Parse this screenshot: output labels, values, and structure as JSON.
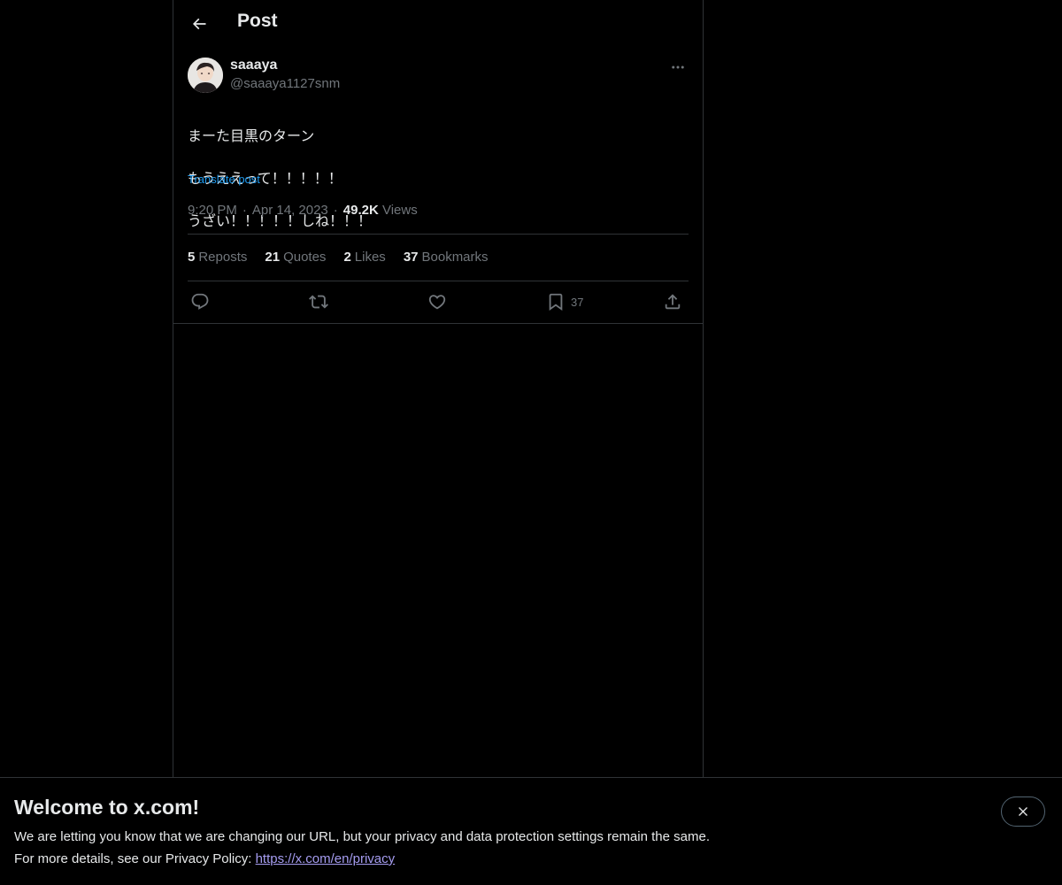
{
  "header": {
    "title": "Post",
    "back_icon": "arrow-left-icon"
  },
  "post": {
    "author_name": "saaaya",
    "author_handle": "@saaaya1127snm",
    "text_lines": [
      "まーた目黒のターン",
      "もうええって！！！！！",
      "うざい！！！！！しね！！！"
    ],
    "translate_label": "Translate post",
    "time": "9:20 PM",
    "date": "Apr 14, 2023",
    "separator": "·",
    "views_count": "49.2K",
    "views_label": "Views"
  },
  "stats": {
    "reposts": {
      "count": "5",
      "label": "Reposts"
    },
    "quotes": {
      "count": "21",
      "label": "Quotes"
    },
    "likes": {
      "count": "2",
      "label": "Likes"
    },
    "bookmarks": {
      "count": "37",
      "label": "Bookmarks"
    }
  },
  "actions": {
    "reply_icon": "reply-icon",
    "repost_icon": "repost-icon",
    "like_icon": "heart-icon",
    "bookmark_icon": "bookmark-icon",
    "bookmark_count": "37",
    "share_icon": "share-icon"
  },
  "banner": {
    "title": "Welcome to x.com!",
    "line1": "We are letting you know that we are changing our URL, but your privacy and data protection settings remain the same.",
    "line2_prefix": "For more details, see our Privacy Policy: ",
    "link_text": "https://x.com/en/privacy",
    "close_icon": "close-icon"
  },
  "colors": {
    "background": "#000000",
    "text_primary": "#e7e9ea",
    "text_secondary": "#71767b",
    "link_blue": "#1d9bf0",
    "border": "#2f3336",
    "banner_link": "#a59cf0"
  }
}
